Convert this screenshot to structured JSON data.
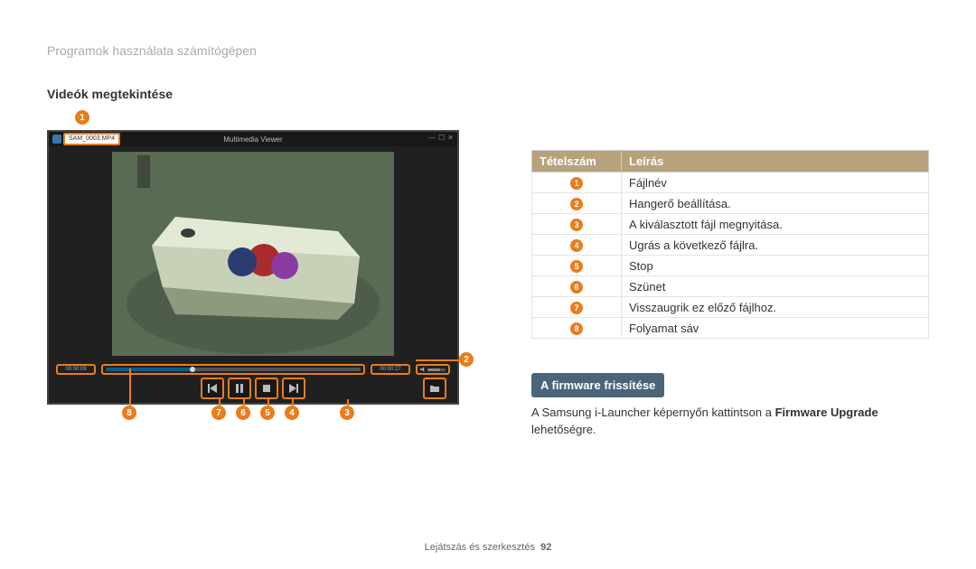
{
  "breadcrumb": "Programok használata számítógépen",
  "section_title": "Videók megtekintése",
  "viewer": {
    "title": "Multimedia Viewer",
    "filename": "SAM_0003.MP4",
    "time_elapsed": "00:00:09",
    "time_total": "00:00:27"
  },
  "callouts": {
    "c1": "1",
    "c2": "2",
    "c3": "3",
    "c4": "4",
    "c5": "5",
    "c6": "6",
    "c7": "7",
    "c8": "8"
  },
  "table": {
    "head": {
      "num": "Tételszám",
      "desc": "Leírás"
    },
    "rows": [
      {
        "n": "1",
        "d": "Fájlnév"
      },
      {
        "n": "2",
        "d": "Hangerő beállítása."
      },
      {
        "n": "3",
        "d": "A kiválasztott fájl megnyitása."
      },
      {
        "n": "4",
        "d": "Ugrás a következő fájlra."
      },
      {
        "n": "5",
        "d": "Stop"
      },
      {
        "n": "6",
        "d": "Szünet"
      },
      {
        "n": "7",
        "d": "Visszaugrik ez előző fájlhoz."
      },
      {
        "n": "8",
        "d": "Folyamat sáv"
      }
    ]
  },
  "firmware": {
    "heading": "A firmware frissítése",
    "text_pre": "A Samsung i-Launcher képernyőn kattintson a ",
    "text_bold": "Firmware Upgrade",
    "text_post": " lehetőségre."
  },
  "footer": {
    "section": "Lejátszás és szerkesztés",
    "page": "92"
  }
}
